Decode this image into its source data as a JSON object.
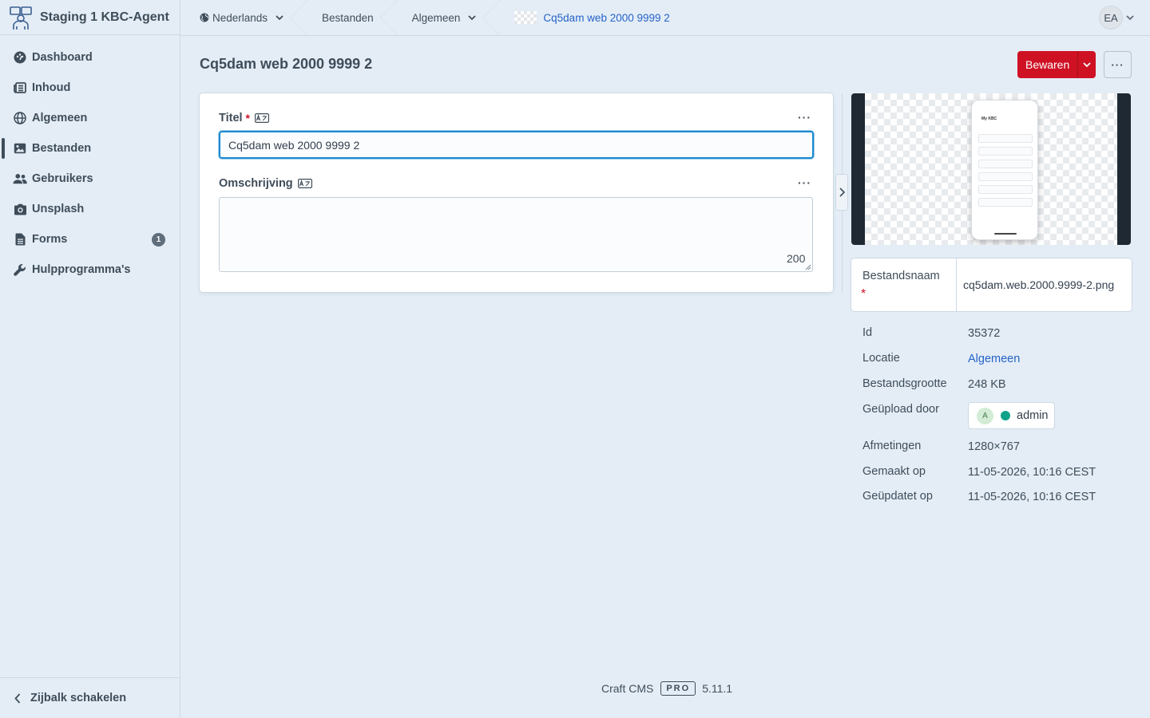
{
  "site": {
    "name": "Staging 1 KBC-Agent"
  },
  "nav": [
    {
      "label": "Dashboard",
      "icon": "gauge-icon",
      "active": false
    },
    {
      "label": "Inhoud",
      "icon": "newspaper-icon",
      "active": false
    },
    {
      "label": "Algemeen",
      "icon": "globe-icon",
      "active": false
    },
    {
      "label": "Bestanden",
      "icon": "image-icon",
      "active": true
    },
    {
      "label": "Gebruikers",
      "icon": "users-icon",
      "active": false
    },
    {
      "label": "Unsplash",
      "icon": "camera-icon",
      "active": false
    },
    {
      "label": "Forms",
      "icon": "file-icon",
      "active": false,
      "badge": "1"
    },
    {
      "label": "Hulpprogramma's",
      "icon": "wrench-icon",
      "active": false
    }
  ],
  "sidebar_footer": {
    "label": "Zijbalk schakelen"
  },
  "breadcrumb": {
    "site": "Nederlands",
    "section": "Bestanden",
    "volume": "Algemeen",
    "current": "Cq5dam web 2000 9999 2"
  },
  "user": {
    "initials": "EA"
  },
  "page": {
    "title": "Cq5dam web 2000 9999 2"
  },
  "actions": {
    "save_label": "Bewaren",
    "more_label": "···"
  },
  "form": {
    "title_label": "Titel",
    "title_value": "Cq5dam web 2000 9999 2",
    "description_label": "Omschrijving",
    "description_value": "",
    "description_counter": "200",
    "required_mark": "*",
    "field_more": "···"
  },
  "preview": {
    "phone_title": "My KBC"
  },
  "meta": {
    "filename_label": "Bestandsnaam",
    "filename_value": "cq5dam.web.2000.9999-2.png",
    "rows": [
      {
        "label": "Id",
        "value": "35372"
      },
      {
        "label": "Locatie",
        "value": "Algemeen"
      },
      {
        "label": "Bestandsgrootte",
        "value": "248 KB"
      },
      {
        "label": "Geüpload door",
        "value": "admin",
        "avatar": "A"
      },
      {
        "label": "Afmetingen",
        "value": "1280×767"
      },
      {
        "label": "Gemaakt op",
        "value": "11-05-2026, 10:16 CEST"
      },
      {
        "label": "Geüpdatet op",
        "value": "11-05-2026, 10:16 CEST"
      }
    ]
  },
  "footer": {
    "product": "Craft CMS",
    "edition": "PRO",
    "version": "5.11.1"
  },
  "colors": {
    "accent": "#cf1124",
    "link": "#2563c9",
    "focus": "#1b8ad0",
    "status_dot": "#10a38a"
  }
}
